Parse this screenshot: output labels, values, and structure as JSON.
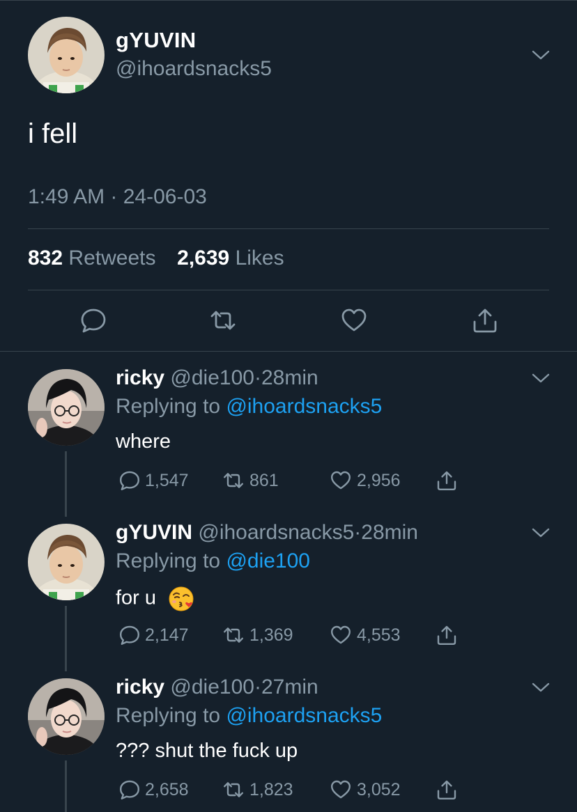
{
  "main_tweet": {
    "name": "gYUVIN",
    "handle": "@ihoardsnacks5",
    "text": "i fell",
    "timestamp": "1:49 AM · 24-06-03",
    "retweets_count": "832",
    "retweets_label": "Retweets",
    "likes_count": "2,639",
    "likes_label": "Likes",
    "actions": [
      "reply-icon",
      "retweet-icon",
      "like-icon",
      "share-icon"
    ]
  },
  "replies": [
    {
      "name": "ricky",
      "handle": "@die100",
      "sep": "·",
      "time": "28min",
      "replying_prefix": "Replying to",
      "replying_to": "@ihoardsnacks5",
      "text": "where",
      "replies": "1,547",
      "retweets": "861",
      "likes": "2,956"
    },
    {
      "name": "gYUVIN",
      "handle": "@ihoardsnacks5",
      "sep": "·",
      "time": "28min",
      "replying_prefix": "Replying to",
      "replying_to": "@die100",
      "text": "for u",
      "emoji": "face-blowing-a-kiss",
      "replies": "2,147",
      "retweets": "1,369",
      "likes": "4,553"
    },
    {
      "name": "ricky",
      "handle": "@die100",
      "sep": "·",
      "time": "27min",
      "replying_prefix": "Replying to",
      "replying_to": "@ihoardsnacks5",
      "text": "??? shut the fuck up",
      "replies": "2,658",
      "retweets": "1,823",
      "likes": "3,052"
    }
  ],
  "colors": {
    "background": "#15202b",
    "divider": "#38444d",
    "secondary_text": "#8899a6",
    "link": "#1da1f2"
  }
}
